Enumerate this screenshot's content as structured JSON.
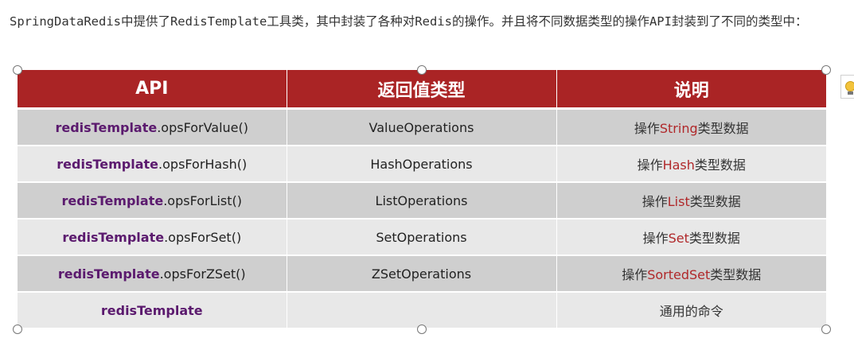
{
  "intro_text": "SpringDataRedis中提供了RedisTemplate工具类，其中封装了各种对Redis的操作。并且将不同数据类型的操作API封装到了不同的类型中：",
  "table": {
    "headers": [
      "API",
      "返回值类型",
      "说明"
    ],
    "rows": [
      {
        "api_prefix": "redisTemplate",
        "api_method": ".opsForValue()",
        "return_type": "ValueOperations",
        "desc_pre": "操作",
        "desc_type": "String",
        "desc_post": "类型数据"
      },
      {
        "api_prefix": "redisTemplate",
        "api_method": ".opsForHash()",
        "return_type": "HashOperations",
        "desc_pre": "操作",
        "desc_type": "Hash",
        "desc_post": "类型数据"
      },
      {
        "api_prefix": "redisTemplate",
        "api_method": ".opsForList()",
        "return_type": "ListOperations",
        "desc_pre": "操作",
        "desc_type": "List",
        "desc_post": "类型数据"
      },
      {
        "api_prefix": "redisTemplate",
        "api_method": ".opsForSet()",
        "return_type": "SetOperations",
        "desc_pre": "操作",
        "desc_type": "Set",
        "desc_post": "类型数据"
      },
      {
        "api_prefix": "redisTemplate",
        "api_method": ".opsForZSet()",
        "return_type": "ZSetOperations",
        "desc_pre": "操作",
        "desc_type": "SortedSet",
        "desc_post": "类型数据"
      },
      {
        "api_prefix": "redisTemplate",
        "api_method": "",
        "return_type": "",
        "desc_pre": "通用的命令",
        "desc_type": "",
        "desc_post": ""
      }
    ]
  },
  "colors": {
    "header_bg": "#aa2425",
    "api_prefix": "#5b1a6e",
    "type_highlight": "#b0282a",
    "row_dark": "#cfcfcf",
    "row_light": "#e8e8e8"
  },
  "icons": {
    "side_icon": "lightbulb-icon",
    "handles": "resize-handle-icon"
  }
}
